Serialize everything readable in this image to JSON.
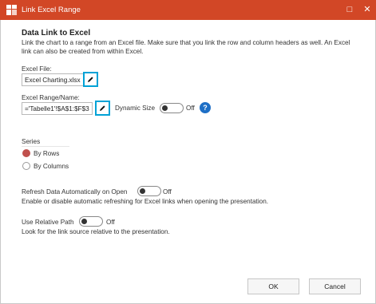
{
  "window": {
    "title": "Link Excel Range",
    "minimize_glyph": "□",
    "close_glyph": "✕",
    "title_icon": "app-grid-icon"
  },
  "intro": {
    "heading": "Data Link to Excel",
    "description_line1": "Link the chart to a range from an Excel file. Make sure that you link the row and column headers as well. An Excel",
    "description_line2": "link can also be created from within Excel."
  },
  "excel_file": {
    "label": "Excel File:",
    "value": "Excel Charting.xlsx",
    "edit_icon": "pencil-icon"
  },
  "excel_range": {
    "label": "Excel Range/Name:",
    "value": "='Tabelle1'!$A$1:$F$3",
    "edit_icon": "pencil-icon",
    "dynamic_size_label": "Dynamic Size",
    "dynamic_size_state": "Off",
    "help_glyph": "?"
  },
  "series": {
    "label": "Series",
    "options": [
      {
        "label": "By Rows",
        "selected": true
      },
      {
        "label": "By Columns",
        "selected": false
      }
    ]
  },
  "refresh": {
    "label": "Refresh Data Automatically on Open",
    "state": "Off",
    "description": "Enable or disable automatic refreshing for Excel links when opening the presentation."
  },
  "relative_path": {
    "label": "Use Relative Path",
    "state": "Off",
    "description": "Look for the link source relative to the presentation."
  },
  "buttons": {
    "ok": "OK",
    "cancel": "Cancel"
  },
  "colors": {
    "titlebar": "#d24726",
    "accent_border": "#00a2d6",
    "help_badge": "#1e6fc6",
    "radio_selected": "#c0504d"
  }
}
